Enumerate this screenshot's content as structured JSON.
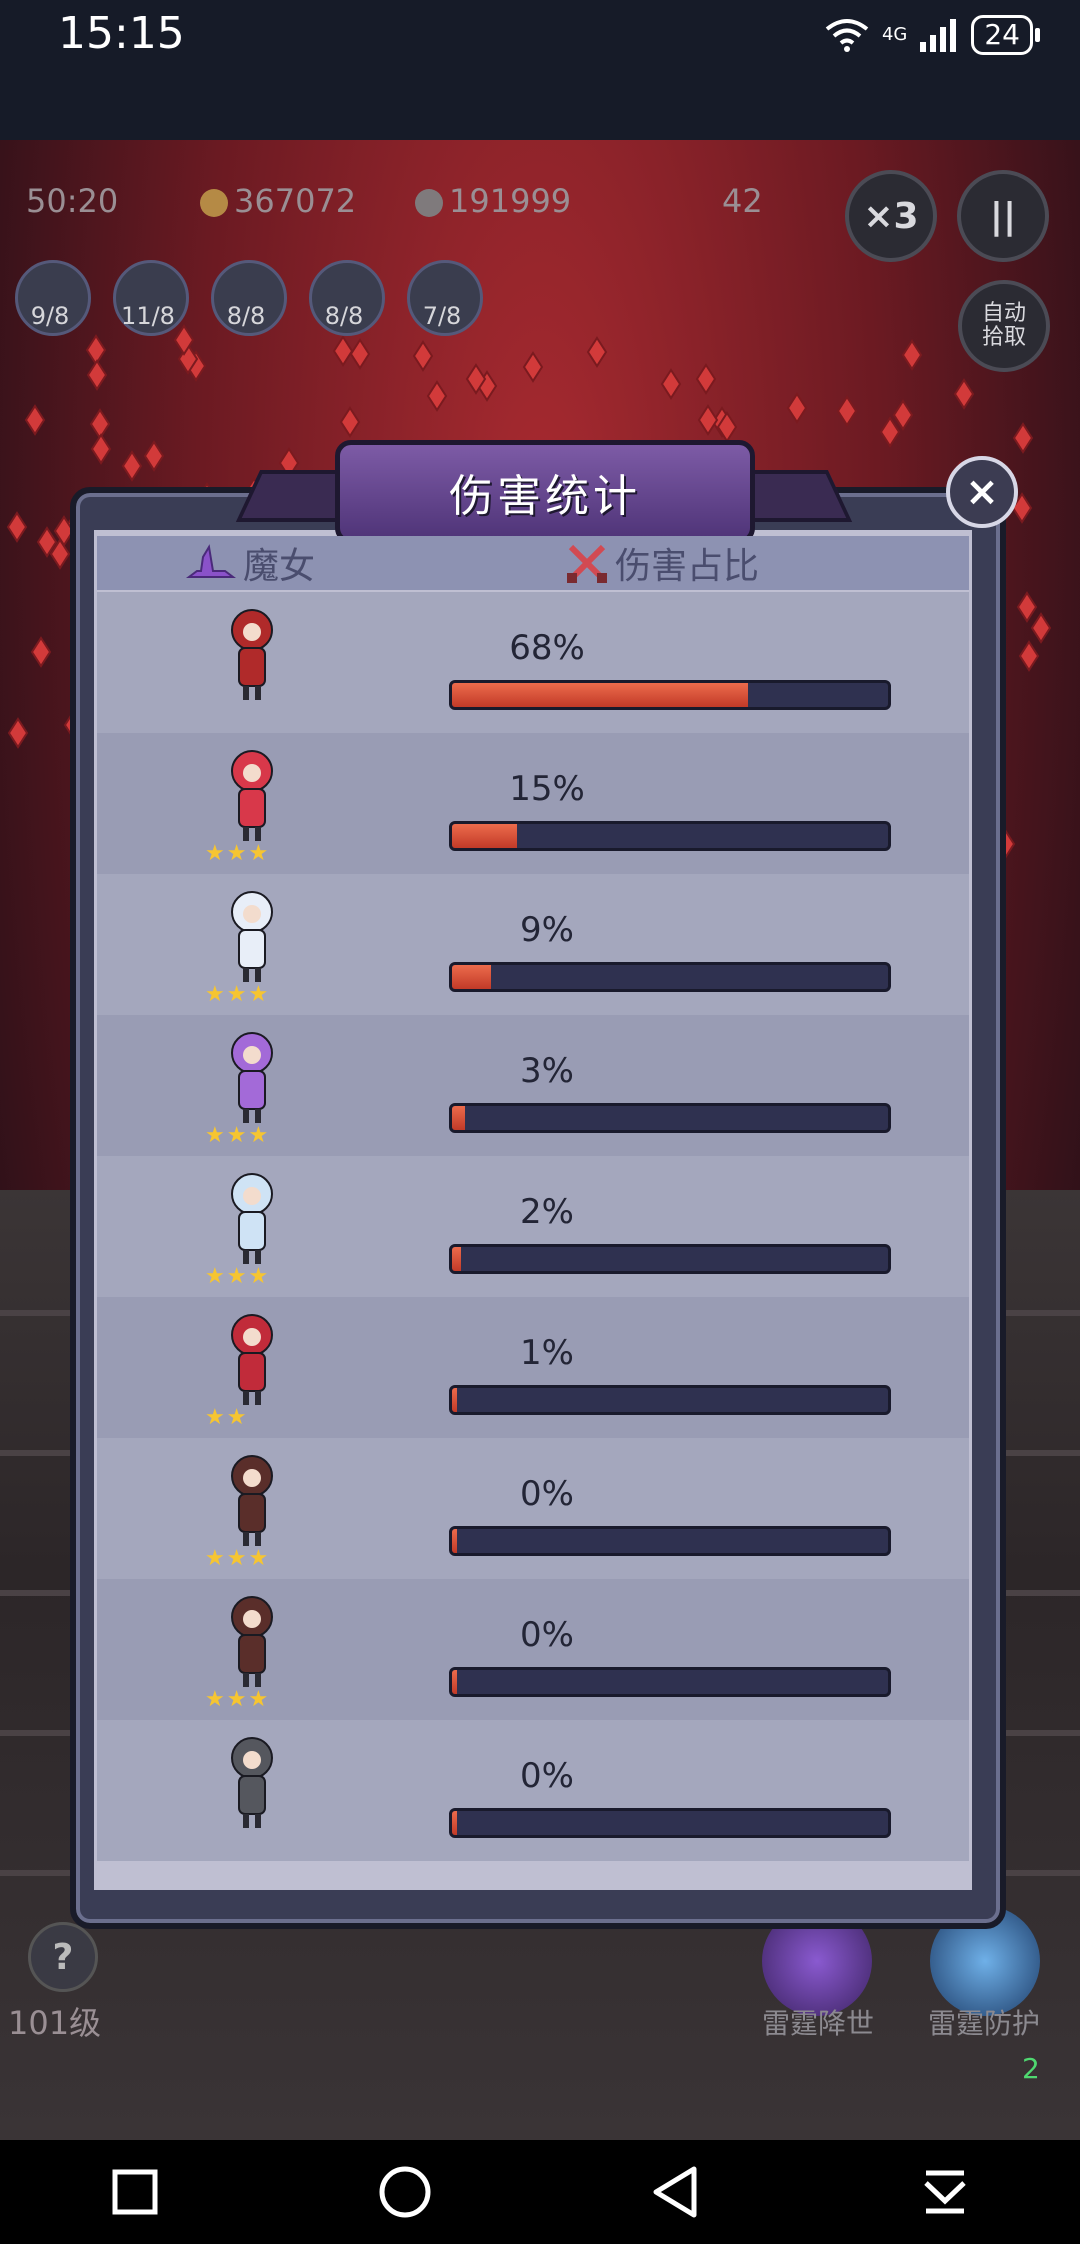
{
  "status_bar": {
    "time": "15:15",
    "network": "4G",
    "battery": "24"
  },
  "game_hud": {
    "timer": "50:20",
    "coins": "367072",
    "kills": "191999",
    "wave": "42",
    "speed_label": "×3",
    "pause_label": "||",
    "auto_pickup_label": "自动\n拾取",
    "skills": [
      {
        "count": "9/8"
      },
      {
        "count": "11/8"
      },
      {
        "count": "8/8"
      },
      {
        "count": "8/8"
      },
      {
        "count": "7/8"
      }
    ],
    "level_label": "101级",
    "help_label": "?",
    "bottom_skills": [
      {
        "label": "雷霆降世"
      },
      {
        "label": "雷霆防护",
        "badge": "2"
      }
    ]
  },
  "modal": {
    "title": "伤害统计",
    "close_label": "×",
    "header_left": "魔女",
    "header_right": "伤害占比",
    "rows": [
      {
        "percent": "68%",
        "fill": 0.68,
        "stars": "",
        "color": "#b02a2a"
      },
      {
        "percent": "15%",
        "fill": 0.15,
        "stars": "★★★",
        "color": "#d8384a"
      },
      {
        "percent": "9%",
        "fill": 0.09,
        "stars": "★★★",
        "color": "#e8eef8"
      },
      {
        "percent": "3%",
        "fill": 0.03,
        "stars": "★★★",
        "color": "#a36ad8"
      },
      {
        "percent": "2%",
        "fill": 0.02,
        "stars": "★★★",
        "color": "#cfe3f5"
      },
      {
        "percent": "1%",
        "fill": 0.01,
        "stars": "★★",
        "color": "#c12b3a"
      },
      {
        "percent": "0%",
        "fill": 0.0,
        "stars": "★★★",
        "color": "#5a2e2a"
      },
      {
        "percent": "0%",
        "fill": 0.0,
        "stars": "★★★",
        "color": "#5a2e2a"
      },
      {
        "percent": "0%",
        "fill": 0.0,
        "stars": "",
        "color": "#55575e"
      }
    ]
  },
  "nav": {
    "buttons": [
      "recent-apps",
      "home",
      "back",
      "download"
    ]
  },
  "colors": {
    "bar_fill": "#d9503a",
    "bar_track": "#2f3150",
    "star": "#f6c531",
    "title_plate": "#6a4a94"
  }
}
